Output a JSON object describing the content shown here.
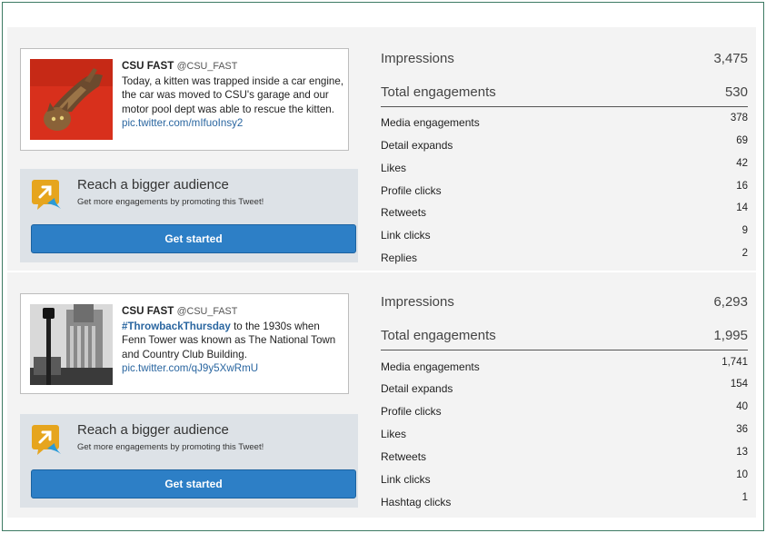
{
  "tweets": [
    {
      "author": "CSU FAST",
      "handle": "@CSU_FAST",
      "text": "Today, a kitten was trapped inside a car engine, the car was moved to CSU's garage and our motor pool dept was able to rescue the kitten.",
      "link": "pic.twitter.com/mIfuoInsy2",
      "image": "kitten-photo",
      "promo": {
        "title": "Reach a bigger audience",
        "subtitle": "Get more engagements by promoting this Tweet!",
        "button": "Get started"
      },
      "impressions": {
        "label": "Impressions",
        "value": "3,475"
      },
      "total": {
        "label": "Total engagements",
        "value": "530"
      },
      "metrics": [
        {
          "label": "Media engagements",
          "value": "378"
        },
        {
          "label": "Detail expands",
          "value": "69"
        },
        {
          "label": "Likes",
          "value": "42"
        },
        {
          "label": "Profile clicks",
          "value": "16"
        },
        {
          "label": "Retweets",
          "value": "14"
        },
        {
          "label": "Link clicks",
          "value": "9"
        },
        {
          "label": "Replies",
          "value": "2"
        }
      ]
    },
    {
      "author": "CSU FAST",
      "handle": "@CSU_FAST",
      "hashtag": "#ThrowbackThursday",
      "text": "to the 1930s when Fenn Tower was known as The National Town and Country Club Building.",
      "link": "pic.twitter.com/qJ9y5XwRmU",
      "image": "fenn-tower-photo",
      "promo": {
        "title": "Reach a bigger audience",
        "subtitle": "Get more engagements by promoting this Tweet!",
        "button": "Get started"
      },
      "impressions": {
        "label": "Impressions",
        "value": "6,293"
      },
      "total": {
        "label": "Total engagements",
        "value": "1,995"
      },
      "metrics": [
        {
          "label": "Media engagements",
          "value": "1,741"
        },
        {
          "label": "Detail expands",
          "value": "154"
        },
        {
          "label": "Profile clicks",
          "value": "40"
        },
        {
          "label": "Likes",
          "value": "36"
        },
        {
          "label": "Retweets",
          "value": "13"
        },
        {
          "label": "Link clicks",
          "value": "10"
        },
        {
          "label": "Hashtag clicks",
          "value": "1"
        }
      ]
    }
  ],
  "colors": {
    "button": "#2d7fc6",
    "link": "#2a66a0",
    "panel": "#f3f3f3",
    "promo": "#dde2e7",
    "promo_icon": "#e6a51e"
  }
}
